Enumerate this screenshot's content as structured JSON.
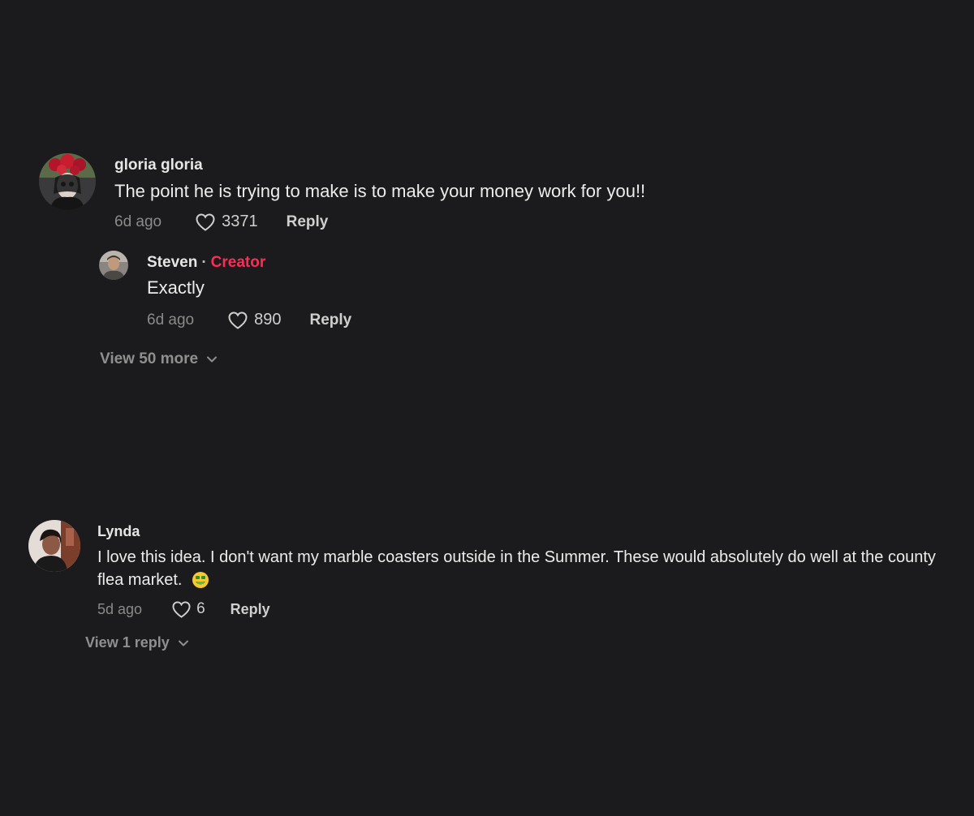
{
  "comments": [
    {
      "username": "gloria gloria",
      "text": "The point he is trying to make is to make your money work for you!!",
      "time": "6d ago",
      "likes": "3371",
      "reply_label": "Reply",
      "replies": [
        {
          "username": "Steven",
          "separator": "·",
          "creator_label": "Creator",
          "text": "Exactly",
          "time": "6d ago",
          "likes": "890",
          "reply_label": "Reply"
        }
      ],
      "view_more_label": "View 50 more"
    },
    {
      "username": "Lynda",
      "text": "I love this idea. I don't want my marble coasters outside in the Summer. These would absolutely do well at the county flea market.",
      "emoji": "money-mouth-face",
      "time": "5d ago",
      "likes": "6",
      "reply_label": "Reply",
      "view_more_label": "View 1 reply"
    }
  ],
  "colors": {
    "background": "#1b1b1d",
    "creator": "#fe2c55",
    "muted": "#8a8a8a"
  }
}
